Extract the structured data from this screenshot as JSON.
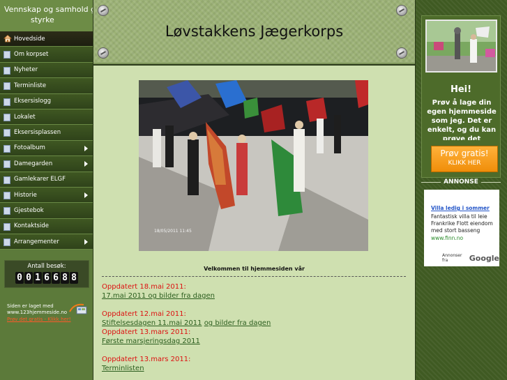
{
  "sidebar": {
    "slogan_line1": "Vennskap og samhold gir",
    "slogan_line2": "styrke",
    "items": [
      {
        "label": "Hovedside"
      },
      {
        "label": "Om korpset"
      },
      {
        "label": "Nyheter"
      },
      {
        "label": "Terminliste"
      },
      {
        "label": "Eksersislogg"
      },
      {
        "label": "Lokalet"
      },
      {
        "label": "Eksersisplassen"
      },
      {
        "label": "Fotoalbum"
      },
      {
        "label": "Damegarden"
      },
      {
        "label": "Gamlekarer ELGF"
      },
      {
        "label": "Historie"
      },
      {
        "label": "Gjestebok"
      },
      {
        "label": "Kontaktside"
      },
      {
        "label": "Arrangementer"
      }
    ],
    "counter_label": "Antall besøk:",
    "counter_digits": [
      "0",
      "0",
      "1",
      "6",
      "6",
      "8",
      "8"
    ],
    "credit_line1": "Siden er laget med",
    "credit_line2": "www.123hjemmeside.no",
    "credit_link": "Prøv det gratis - Klikk her!"
  },
  "header": {
    "title": "Løvstakkens Jægerkorps"
  },
  "main": {
    "welcome": "Velkommen til hjemmesiden vår",
    "updates": [
      {
        "title": "Oppdatert 18.mai 2011:",
        "links": [
          "17.mai 2011 og bilder fra dagen "
        ]
      },
      {
        "title": "Oppdatert 12.mai 2011:",
        "links": [
          "Stiftelsesdagen 11.mai 2011 ",
          " og bilder fra dagen "
        ]
      },
      {
        "title": "Oppdatert 13.mars 2011:",
        "links": [
          "Første marsjeringsdag 2011"
        ]
      },
      {
        "title": "Oppdatert 13.mars 2011:",
        "links": [
          "Terminlisten"
        ]
      }
    ]
  },
  "right": {
    "hei": "Hei!",
    "promo_text": "Prøv å lage din egen hjemmeside som jeg. Det er enkelt, og du kan prøve det",
    "btn_line1": "Prøv gratis!",
    "btn_line2": "KLIKK HER",
    "annonse": "ANNONSE",
    "ad_title": "Villa ledig i sommer",
    "ad_body": "Fantastisk villa til leie Frankrike Flott eiendom med stort basseng",
    "ad_url": "www.finn.no",
    "ad_footer": "Annonser fra",
    "ad_google": "Google"
  }
}
